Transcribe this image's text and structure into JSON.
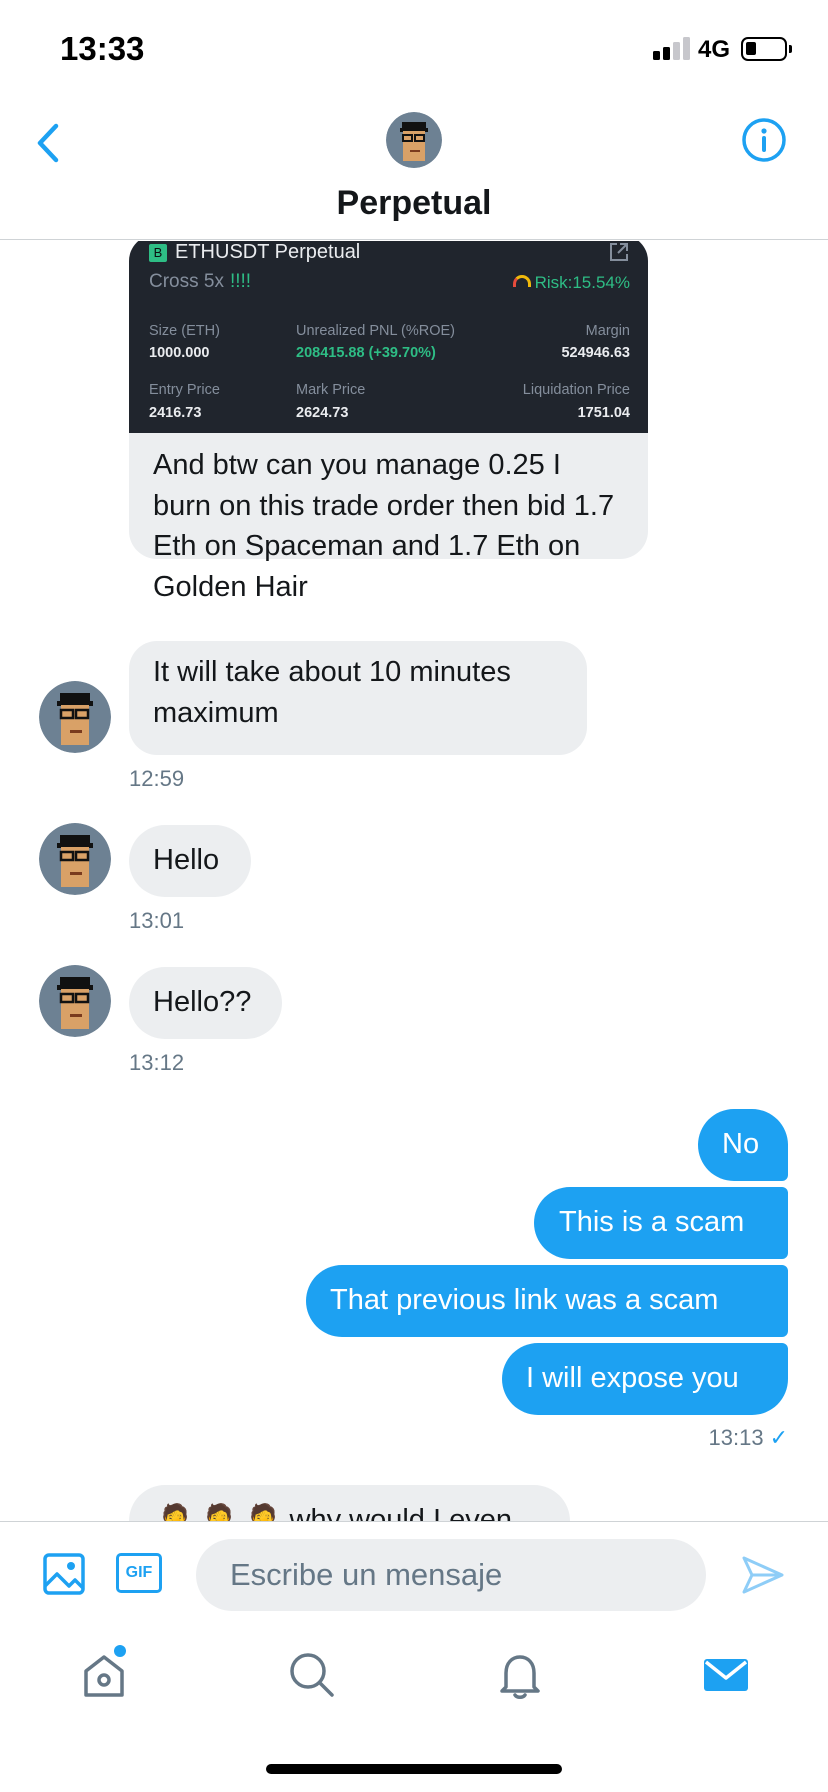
{
  "status_bar": {
    "time": "13:33",
    "network": "4G"
  },
  "header": {
    "title": "Perpetual",
    "back_icon": "chevron-left-icon",
    "info_icon": "info-icon"
  },
  "trade_card": {
    "pair": "ETHUSDT Perpetual",
    "badge": "B",
    "margin_mode": "Cross 5x",
    "warning": "!!!!",
    "risk": "Risk:15.54%",
    "size_label": "Size (ETH)",
    "size_value": "1000.000",
    "pnl_label": "Unrealized PNL (%ROE)",
    "pnl_value": "208415.88 (+39.70%)",
    "margin_label": "Margin",
    "margin_value": "524946.63",
    "entry_label": "Entry Price",
    "entry_value": "2416.73",
    "mark_label": "Mark Price",
    "mark_value": "2624.73",
    "liq_label": "Liquidation Price",
    "liq_value": "1751.04",
    "colors": {
      "background": "#20252d",
      "positive": "#2ebd85"
    }
  },
  "messages": {
    "m1": "And btw can you manage 0.25 I burn on this trade order then bid 1.7 Eth on Spaceman and 1.7 Eth on Golden Hair",
    "m2": "It will take about 10 minutes maximum",
    "t1": "12:59",
    "m3": "Hello",
    "t2": "13:01",
    "m4": "Hello??",
    "t3": "13:12",
    "o1": "No",
    "o2": "This is a scam",
    "o3": "That previous link was a scam",
    "o4": "I will expose you",
    "t4": "13:13",
    "partial": "🤦 🤦 🤦 why would I even"
  },
  "composer": {
    "placeholder": "Escribe un mensaje",
    "gif_label": "GIF"
  },
  "tabs": [
    "home-icon",
    "search-icon",
    "notifications-icon",
    "messages-icon"
  ],
  "colors": {
    "accent": "#1da1f2",
    "incoming_bubble": "#eceef0",
    "secondary_text": "#657786"
  }
}
